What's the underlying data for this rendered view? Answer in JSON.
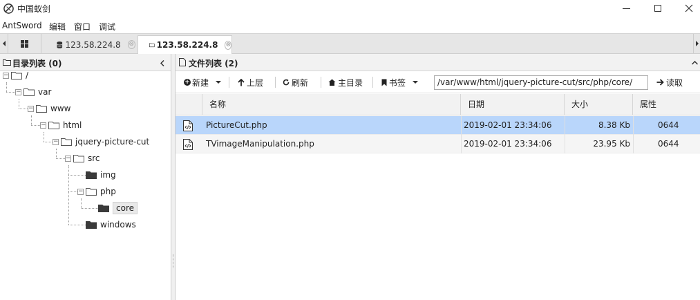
{
  "window": {
    "title": "中国蚁剑",
    "controls": {
      "minimize": "—",
      "maximize": "☐",
      "close": "✕"
    }
  },
  "menu": [
    "AntSword",
    "编辑",
    "窗口",
    "调试"
  ],
  "tabs": [
    {
      "label": "123.58.224.8",
      "icon": "database-icon",
      "active": false
    },
    {
      "label": "123.58.224.8",
      "icon": "folder-icon",
      "active": true
    }
  ],
  "tab_close": "⊗",
  "left_panel": {
    "title": "目录列表 (0)",
    "tree": [
      {
        "label": "/",
        "depth": 0,
        "expanded": true
      },
      {
        "label": "var",
        "depth": 1,
        "expanded": true
      },
      {
        "label": "www",
        "depth": 2,
        "expanded": true
      },
      {
        "label": "html",
        "depth": 3,
        "expanded": true
      },
      {
        "label": "jquery-picture-cut",
        "depth": 4,
        "expanded": true
      },
      {
        "label": "src",
        "depth": 5,
        "expanded": true
      },
      {
        "label": "img",
        "depth": 6,
        "expanded": false
      },
      {
        "label": "php",
        "depth": 6,
        "expanded": true
      },
      {
        "label": "core",
        "depth": 7,
        "expanded": false,
        "selected": true
      },
      {
        "label": "windows",
        "depth": 6,
        "expanded": false
      }
    ]
  },
  "right_panel": {
    "title": "文件列表 (2)",
    "toolbar": {
      "new": "新建",
      "up": "上层",
      "refresh": "刷新",
      "home": "主目录",
      "bookmark": "书签",
      "path": "/var/www/html/jquery-picture-cut/src/php/core/",
      "read": "读取"
    },
    "columns": [
      "名称",
      "日期",
      "大小",
      "属性"
    ],
    "files": [
      {
        "name": "PictureCut.php",
        "date": "2019-02-01 23:34:06",
        "size": "8.38 Kb",
        "perm": "0644",
        "selected": true
      },
      {
        "name": "TVimageManipulation.php",
        "date": "2019-02-01 23:34:06",
        "size": "23.95 Kb",
        "perm": "0644",
        "selected": false
      }
    ]
  }
}
